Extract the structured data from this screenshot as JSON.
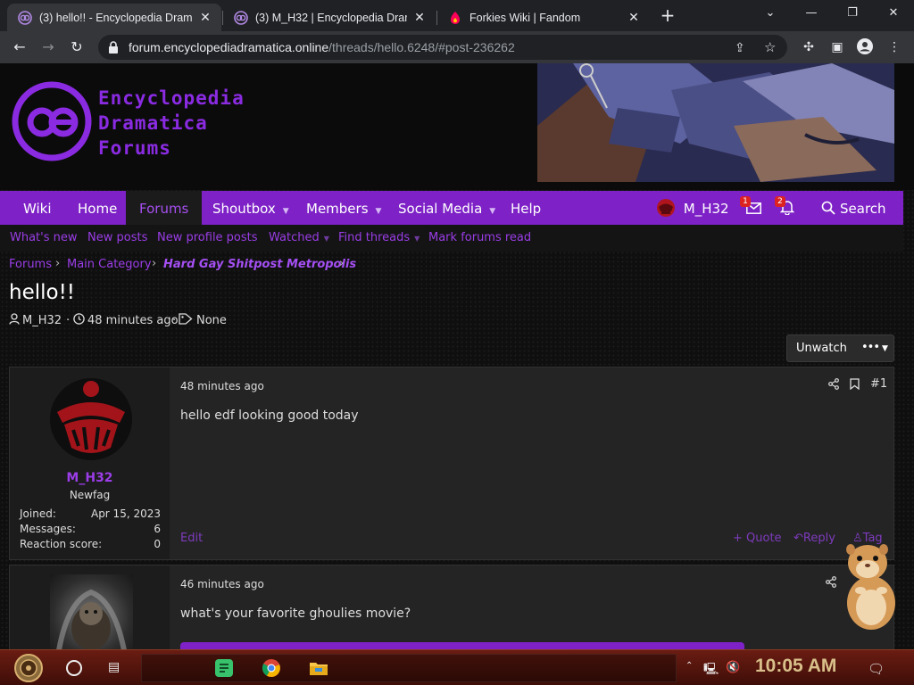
{
  "browser": {
    "tabs": [
      {
        "title": "(3) hello!! - Encyclopedia Drama",
        "active": true
      },
      {
        "title": "(3) M_H32 | Encyclopedia Dram",
        "active": false
      },
      {
        "title": "Forkies Wiki | Fandom",
        "active": false
      }
    ],
    "url_host": "forum.encyclopediadramatica.online",
    "url_path": "/threads/hello.6248/#post-236262"
  },
  "site": {
    "logo_lines": [
      "Encyclopedia",
      "Dramatica",
      "Forums"
    ],
    "brand_color": "#7e22c7",
    "accent_color": "#9b3de8"
  },
  "nav": {
    "wiki": "Wiki",
    "home": "Home",
    "forums": "Forums",
    "shoutbox": "Shoutbox",
    "members": "Members",
    "social_media": "Social Media",
    "help": "Help",
    "user": "M_H32",
    "inbox_badge": "1",
    "alerts_badge": "2",
    "search": "Search"
  },
  "subnav": {
    "whats_new": "What's new",
    "new_posts": "New posts",
    "new_profile_posts": "New profile posts",
    "watched": "Watched",
    "find_threads": "Find threads",
    "mark_read": "Mark forums read"
  },
  "breadcrumb": {
    "forums": "Forums",
    "main_category": "Main Category",
    "subforum": "Hard Gay Shitpost Metropolis"
  },
  "thread": {
    "title": "hello!!",
    "author": "M_H32",
    "time": "48 minutes ago",
    "tags": "None",
    "unwatch": "Unwatch",
    "more": "•••"
  },
  "posts": [
    {
      "user": "M_H32",
      "user_title": "Newfag",
      "stats": [
        {
          "label": "Joined:",
          "value": "Apr 15, 2023"
        },
        {
          "label": "Messages:",
          "value": "6"
        },
        {
          "label": "Reaction score:",
          "value": "0"
        }
      ],
      "time": "48 minutes ago",
      "number": "#1",
      "body": "hello edf looking good today",
      "edit": "Edit",
      "quote": "+ Quote",
      "reply": "Reply",
      "tag": "Tag"
    },
    {
      "time": "46 minutes ago",
      "body": "what's your favorite ghoulies movie?"
    }
  ],
  "taskbar": {
    "clock": "10:05 AM"
  }
}
